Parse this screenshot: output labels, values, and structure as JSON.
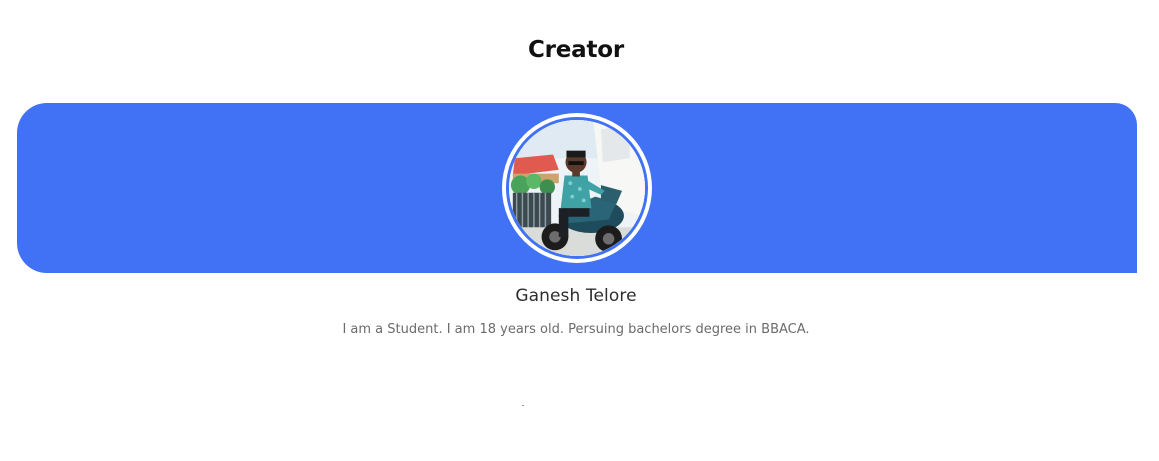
{
  "section": {
    "title": "Creator"
  },
  "profile": {
    "name": "Ganesh Telore",
    "bio": "I am a Student. I am 18 years old. Persuing bachelors degree in BBACA.",
    "avatar_alt": "profile photo"
  },
  "colors": {
    "accent": "#4171f4",
    "title": "#111111",
    "name": "#2d2d2d",
    "bio": "#6b6b6b",
    "background": "#ffffff"
  }
}
